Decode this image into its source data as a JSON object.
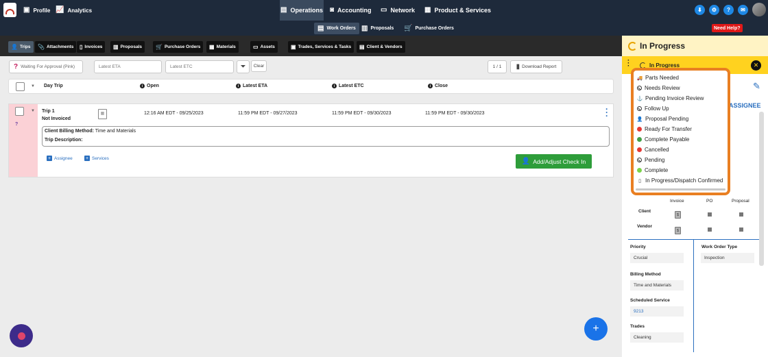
{
  "topnav": {
    "profile": "Profile",
    "analytics": "Analytics",
    "operations": "Operations",
    "accounting": "Accounting",
    "network": "Network",
    "products": "Product & Services"
  },
  "subnav": {
    "work_orders": "Work Orders",
    "proposals": "Proposals",
    "purchase_orders": "Purchase Orders",
    "need_help": "Need Help?"
  },
  "tabs": [
    "Trips",
    "Attachments",
    "Invoices",
    "Proposals",
    "Purchase Orders",
    "Materials",
    "Assets",
    "Trades, Services & Tasks",
    "Client & Vendors"
  ],
  "filters": {
    "status_filter": "Waiting For Approval (Pink)",
    "latest_eta_placeholder": "Latest ETA",
    "latest_etc_placeholder": "Latest ETC",
    "clear": "Clear",
    "pagination": "1 / 1",
    "download": "Download Report"
  },
  "table": {
    "headers": {
      "day_trip": "Day Trip",
      "open": "Open",
      "latest_eta": "Latest ETA",
      "latest_etc": "Latest ETC",
      "close": "Close"
    }
  },
  "trip": {
    "name": "Trip 1",
    "status": "Not Invoiced",
    "open": "12:16 AM EDT - 09/25/2023",
    "latest_eta": "11:59 PM EDT - 09/27/2023",
    "latest_etc": "11:59 PM EDT - 09/30/2023",
    "close": "11:59 PM EDT - 09/30/2023",
    "billing_label": "Client Billing Method:",
    "billing_value": "Time and Materials",
    "description_label": "Trip Description:",
    "assignee": "Assignee",
    "services": "Services",
    "checkin": "Add/Adjust Check In"
  },
  "panel": {
    "title": "In Progress",
    "status_selected": "In Progress",
    "assignee_tab": "ASSIGNEE",
    "cols": {
      "invoice": "Invoice",
      "po": "PO",
      "proposal": "Proposal"
    },
    "rows": {
      "client": "Client",
      "vendor": "Vendor"
    },
    "priority_label": "Priority",
    "priority_value": "Crucial",
    "wo_type_label": "Work Order Type",
    "wo_type_value": "Inspection",
    "billing_label": "Billing Method",
    "billing_value": "Time and Materials",
    "scheduled_label": "Scheduled Service",
    "scheduled_value": "9213",
    "trades_label": "Trades",
    "trades_value": "Cleaning"
  },
  "status_menu": [
    {
      "label": "Parts Needed",
      "icon": "truck-icon"
    },
    {
      "label": "Needs Review",
      "icon": "ban-icon"
    },
    {
      "label": "Pending Invoice Review",
      "icon": "anchor-icon"
    },
    {
      "label": "Follow Up",
      "icon": "ban-icon"
    },
    {
      "label": "Proposal Pending",
      "icon": "user-cog-icon"
    },
    {
      "label": "Ready For Transfer",
      "icon": "red-dot-icon",
      "color": "#e53935"
    },
    {
      "label": "Complete Payable",
      "icon": "green-check-icon",
      "color": "#43a047"
    },
    {
      "label": "Cancelled",
      "icon": "red-dot-icon",
      "color": "#e53935"
    },
    {
      "label": "Pending",
      "icon": "ban-icon"
    },
    {
      "label": "Complete",
      "icon": "green-check-icon",
      "color": "#7cd34a"
    },
    {
      "label": "In Progress/Dispatch Confirmed",
      "icon": "doc-icon"
    }
  ],
  "colors": {
    "nav_bg": "#1e2a3b",
    "accent_orange": "#e97f22",
    "status_yellow": "#ffd21f",
    "green": "#2e9d3a",
    "pink": "#fbd1d6"
  }
}
